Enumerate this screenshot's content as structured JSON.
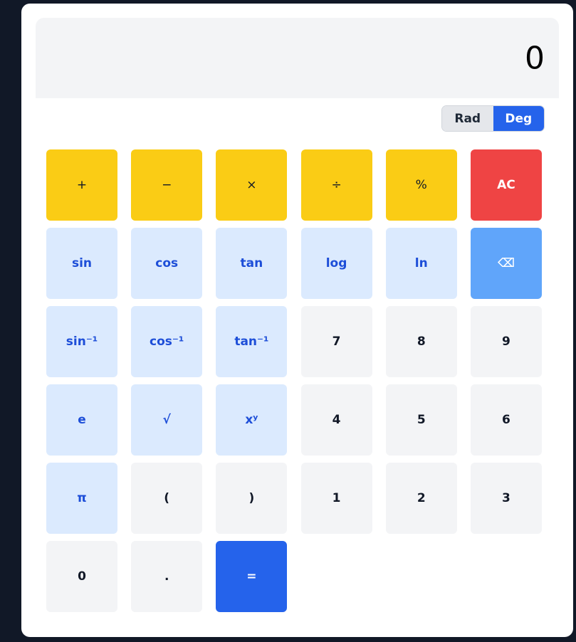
{
  "display": {
    "value": "0"
  },
  "mode": {
    "rad_label": "Rad",
    "deg_label": "Deg",
    "selected": "Deg"
  },
  "keys": {
    "add": "+",
    "subtract": "−",
    "multiply": "×",
    "divide": "÷",
    "percent": "%",
    "all_clear": "AC",
    "sin": "sin",
    "cos": "cos",
    "tan": "tan",
    "log": "log",
    "ln": "ln",
    "backspace": "⌫",
    "asin": "sin⁻¹",
    "acos": "cos⁻¹",
    "atan": "tan⁻¹",
    "seven": "7",
    "eight": "8",
    "nine": "9",
    "e": "e",
    "sqrt": "√",
    "power": "xʸ",
    "four": "4",
    "five": "5",
    "six": "6",
    "pi": "π",
    "open_paren": "(",
    "close_paren": ")",
    "one": "1",
    "two": "2",
    "three": "3",
    "zero": "0",
    "decimal": ".",
    "equals": "="
  },
  "colors": {
    "page_background": "#111827",
    "operator": "#facc15",
    "clear": "#ef4444",
    "function": "#dbeafe",
    "function_text": "#1d4ed8",
    "backspace": "#60a5fa",
    "number": "#f3f4f6",
    "equals": "#2563eb"
  }
}
